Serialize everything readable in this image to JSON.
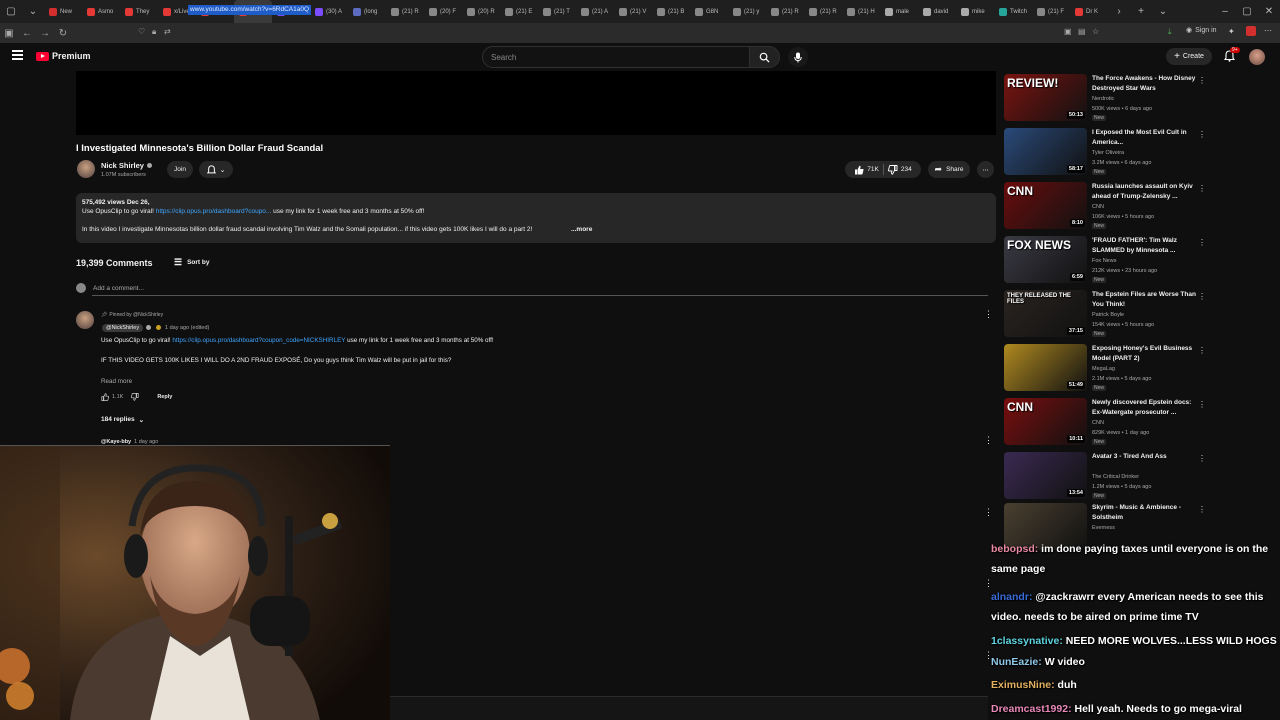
{
  "browser": {
    "tabs": [
      {
        "label": "New",
        "color": "#d32f2f"
      },
      {
        "label": "Asmo",
        "color": "#e53935"
      },
      {
        "label": "They",
        "color": "#e53935"
      },
      {
        "label": "x/Live",
        "color": "#e53935"
      },
      {
        "label": "(207)",
        "color": "#e53935"
      },
      {
        "label": "(2)",
        "color": "#e53935",
        "active": true
      },
      {
        "label": "(30) A",
        "color": "#7c4dff"
      },
      {
        "label": "(30) A",
        "color": "#7c4dff"
      },
      {
        "label": "(long",
        "color": "#5c6bc0"
      },
      {
        "label": "(21) R",
        "color": "#888"
      },
      {
        "label": "(20) F",
        "color": "#888"
      },
      {
        "label": "(20) R",
        "color": "#888"
      },
      {
        "label": "(21) E",
        "color": "#888"
      },
      {
        "label": "(21) T",
        "color": "#888"
      },
      {
        "label": "(21) A",
        "color": "#888"
      },
      {
        "label": "(21) V",
        "color": "#888"
      },
      {
        "label": "(21) B",
        "color": "#888"
      },
      {
        "label": "G8N",
        "color": "#888"
      },
      {
        "label": "(21) y",
        "color": "#888"
      },
      {
        "label": "(21) R",
        "color": "#888"
      },
      {
        "label": "(21) R",
        "color": "#888"
      },
      {
        "label": "(21) H",
        "color": "#888"
      },
      {
        "label": "male",
        "color": "#aaa"
      },
      {
        "label": "david",
        "color": "#aaa"
      },
      {
        "label": "mike",
        "color": "#aaa"
      },
      {
        "label": "Twitch",
        "color": "#26a69a"
      },
      {
        "label": "(21) F",
        "color": "#888"
      },
      {
        "label": "Dr K",
        "color": "#e53935"
      }
    ],
    "url": "www.youtube.com/watch?v=6RdCA1a0Q",
    "sign_in": "Sign in"
  },
  "youtube": {
    "brand": "Premium",
    "search_placeholder": "Search",
    "create_label": "Create",
    "notif_count": "9+"
  },
  "video": {
    "title": "I Investigated Minnesota's Billion Dollar Fraud Scandal",
    "channel": "Nick Shirley",
    "subscribers": "1.07M subscribers",
    "join_label": "Join",
    "likes": "71K",
    "dislikes": "234",
    "share_label": "Share",
    "views_date": "575,492 views  Dec 26,",
    "desc_line1_prefix": "Use OpusClip to go viral! ",
    "desc_line1_link": "https://clip.opus.pro/dashboard?coupo...",
    "desc_line1_suffix": " use my link for 1 week free and 3 months at 50% off!",
    "desc_line2": "In this video I investigate Minnesotas billion dollar fraud scandal involving Tim Walz and the Somali population... if this video gets 100K likes I will do a part 2!",
    "desc_more": "...more"
  },
  "comments": {
    "count": "19,399 Comments",
    "sort_label": "Sort by",
    "add_placeholder": "Add a comment...",
    "pinned_label": "Pinned by @NickShirley",
    "author": "@NickShirley",
    "time": "1 day ago (edited)",
    "text1_prefix": "Use OpusClip to go viral! ",
    "text1_link": "https://clip.opus.pro/dashboard?coupon_code=NICKSHIRLEY",
    "text1_suffix": " use my link for 1 week free and 3 months at 50% off!",
    "text2": "IF THIS VIDEO GETS 100K LIKES I WILL DO A 2ND FRAUD EXPOSÉ, Do you guys think Tim Walz will be put in jail for this?",
    "read_more": "Read more",
    "likes": "1.1K",
    "reply_label": "Reply",
    "replies_label": "184 replies",
    "next_author": "@Kaye-bby",
    "next_time": "1 day ago"
  },
  "recommendations": [
    {
      "title": "The Force Awakens - How Disney Destroyed Star Wars",
      "channel": "Nerdrotic",
      "meta": "500K views • 6 days ago",
      "duration": "50:13",
      "new": "New",
      "thumb_text": "REVIEW!",
      "color": "#7a1410"
    },
    {
      "title": "I Exposed the Most Evil Cult in America...",
      "channel": "Tyler Oliveira",
      "meta": "3.2M views • 6 days ago",
      "duration": "58:17",
      "new": "New",
      "thumb_text": "",
      "color": "#2a4a7a"
    },
    {
      "title": "Russia launches assault on Kyiv ahead of Trump-Zelensky ...",
      "channel": "CNN",
      "meta": "106K views • 5 hours ago",
      "duration": "8:10",
      "new": "New",
      "thumb_text": "CNN",
      "color": "#6a0d0d"
    },
    {
      "title": "'FRAUD FATHER': Tim Walz SLAMMED by Minnesota ...",
      "channel": "Fox News",
      "meta": "212K views • 23 hours ago",
      "duration": "6:59",
      "new": "New",
      "thumb_text": "FOX NEWS",
      "color": "#3a3a44"
    },
    {
      "title": "The Epstein Files are Worse Than You Think!",
      "channel": "Patrick Boyle",
      "meta": "154K views • 5 hours ago",
      "duration": "37:15",
      "new": "New",
      "thumb_text": "THEY RELEASED THE FILES",
      "color": "#2a2420"
    },
    {
      "title": "Exposing Honey's Evil Business Model (PART 2)",
      "channel": "MegaLag",
      "meta": "2.1M views • 5 days ago",
      "duration": "51:49",
      "new": "New",
      "thumb_text": "",
      "color": "#b08a20"
    },
    {
      "title": "Newly discovered Epstein docs: Ex-Watergate prosecutor ...",
      "channel": "CNN",
      "meta": "829K views • 1 day ago",
      "duration": "10:11",
      "new": "New",
      "thumb_text": "CNN",
      "color": "#7a0e0e"
    },
    {
      "title": "Avatar 3 - Tired And Ass",
      "channel": "The Critical Drinker",
      "meta": "1.2M views • 5 days ago",
      "duration": "13:54",
      "new": "New",
      "thumb_text": "",
      "color": "#3a2a52"
    },
    {
      "title": "Skyrim - Music & Ambience - Solstheim",
      "channel": "Everness",
      "meta": "",
      "duration": "",
      "new": "",
      "thumb_text": "",
      "color": "#4a4030"
    }
  ],
  "chat": [
    {
      "user": "bebopsd",
      "color": "#e88aa4",
      "message": "im done paying taxes until everyone is on the same page"
    },
    {
      "user": "alnandr",
      "color": "#3b6bd8",
      "message": "@zackrawrr every American needs to see this video. needs to be aired on prime time TV"
    },
    {
      "user": "1classynative",
      "color": "#5fd4e0",
      "message": "NEED MORE WOLVES...LESS WILD HOGS"
    },
    {
      "user": "NunEazie",
      "color": "#8fc8e8",
      "message": "W video"
    },
    {
      "user": "EximusNine",
      "color": "#e0b060",
      "message": "duh"
    },
    {
      "user": "Dreamcast1992",
      "color": "#e888b8",
      "message": "Hell yeah. Needs to go mega-viral"
    }
  ]
}
